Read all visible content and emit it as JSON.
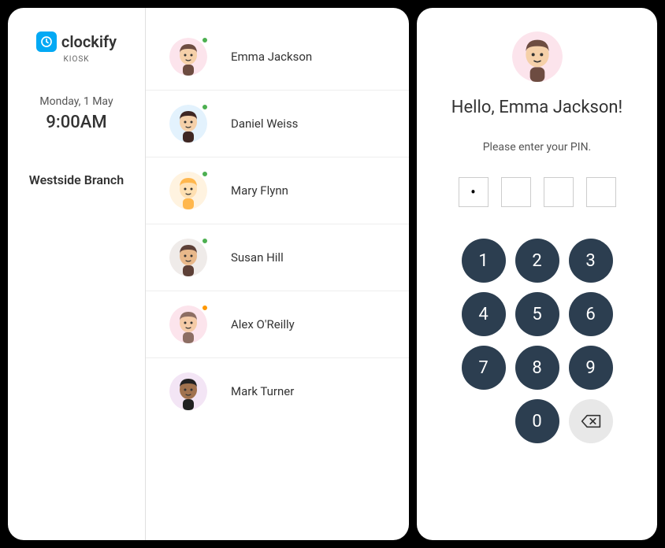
{
  "brand": {
    "name": "clockify",
    "sublabel": "KIOSK"
  },
  "sidebar": {
    "date": "Monday, 1 May",
    "time": "9:00AM",
    "branch": "Westside Branch"
  },
  "users": [
    {
      "name": "Emma Jackson",
      "status": "green",
      "avatar_bg": "#FCE4EC",
      "hair": "#6D4C41",
      "skin": "#F5D0A9"
    },
    {
      "name": "Daniel Weiss",
      "status": "green",
      "avatar_bg": "#E3F2FD",
      "hair": "#3E2723",
      "skin": "#F5D0A9"
    },
    {
      "name": "Mary Flynn",
      "status": "green",
      "avatar_bg": "#FFF3E0",
      "hair": "#FFB74D",
      "skin": "#FFE0B2"
    },
    {
      "name": "Susan Hill",
      "status": "green",
      "avatar_bg": "#EFEBE9",
      "hair": "#5D4037",
      "skin": "#E8B88A"
    },
    {
      "name": "Alex O'Reilly",
      "status": "orange",
      "avatar_bg": "#FCE4EC",
      "hair": "#8D6E63",
      "skin": "#F5CBA7"
    },
    {
      "name": "Mark Turner",
      "status": "none",
      "avatar_bg": "#F3E5F5",
      "hair": "#212121",
      "skin": "#A1724E"
    }
  ],
  "pin_screen": {
    "greeting": "Hello, Emma Jackson!",
    "instruction": "Please enter your PIN.",
    "entered_count": 1,
    "total_digits": 4,
    "avatar_bg": "#FCE4EC",
    "hair": "#6D4C41",
    "skin": "#F5D0A9"
  },
  "keypad": {
    "keys": [
      "1",
      "2",
      "3",
      "4",
      "5",
      "6",
      "7",
      "8",
      "9",
      "",
      "0",
      "back"
    ]
  }
}
